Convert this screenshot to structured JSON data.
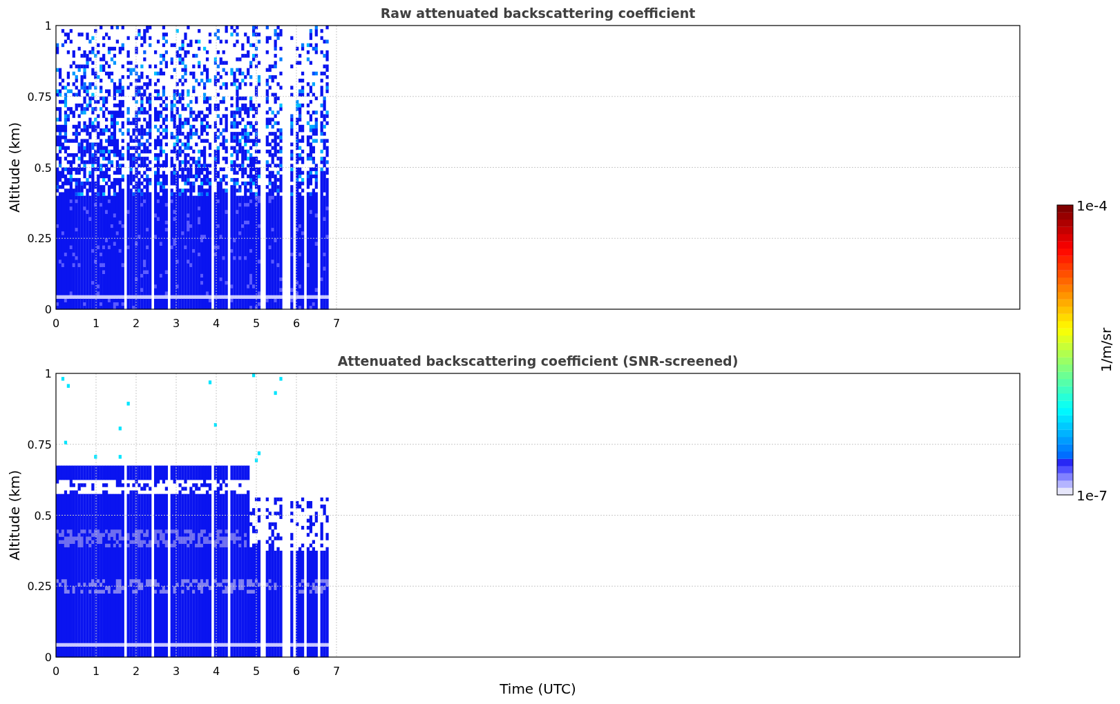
{
  "panels": [
    {
      "kind": "raw",
      "title": "Raw attenuated backscattering coefficient",
      "ylabel": "Altitude (km)",
      "yticks": [
        "1",
        "0.75",
        "0.5",
        "0.25",
        "0"
      ],
      "xticks": [
        "0",
        "1",
        "2",
        "3",
        "4",
        "5",
        "6",
        "7"
      ]
    },
    {
      "kind": "screened",
      "title": "Attenuated backscattering coefficient (SNR-screened)",
      "ylabel": "Altitude (km)",
      "yticks": [
        "1",
        "0.75",
        "0.5",
        "0.25",
        "0"
      ],
      "xticks": [
        "0",
        "1",
        "2",
        "3",
        "4",
        "5",
        "6",
        "7"
      ]
    }
  ],
  "xlabel": "Time (UTC)",
  "colorbar": {
    "label": "1/m/sr",
    "max_label": "1e-4",
    "min_label": "1e-7"
  }
}
